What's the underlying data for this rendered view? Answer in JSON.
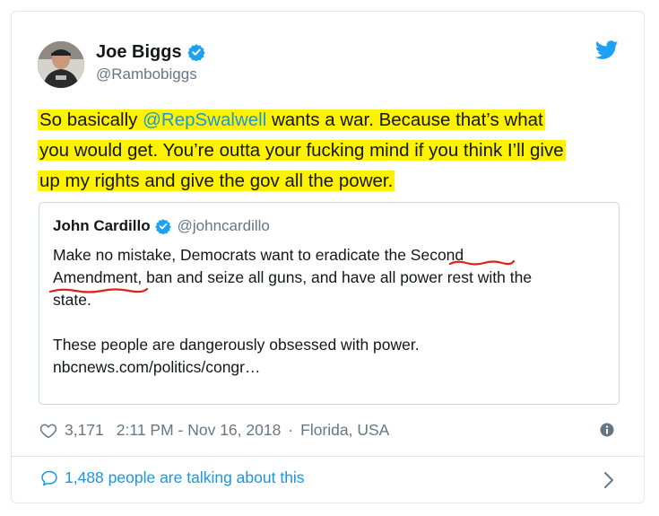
{
  "author": {
    "name": "Joe Biggs",
    "handle": "@Rambobiggs"
  },
  "tweet": {
    "line1_prefix": "So basically ",
    "mention": "@RepSwalwell",
    "line1_suffix": " wants a war. Because that’s what",
    "line2": "you would get. You’re outta your fucking mind if you think I’ll give",
    "line3": "up my rights and give the gov all the power."
  },
  "quote": {
    "name": "John Cardillo",
    "handle": "@johncardillo",
    "line1": "Make no mistake, Democrats want to eradicate the Second",
    "line2": "Amendment, ban and seize all guns, and have all power rest with the",
    "line3": "state.",
    "line4": "These people are dangerously obsessed with power.",
    "line5": "nbcnews.com/politics/congr…"
  },
  "meta": {
    "likes": "3,171",
    "timestamp": "2:11 PM - Nov 16, 2018",
    "separator": "·",
    "location": "Florida, USA"
  },
  "footer": {
    "talking": "1,488 people are talking about this"
  },
  "colors": {
    "highlight": "#fff200",
    "link": "#1b95e0",
    "twitter_blue": "#1da1f2",
    "annotation_red": "#e0201b"
  },
  "icons": [
    "verified-icon",
    "twitter-bird-icon",
    "heart-icon",
    "info-icon",
    "speech-bubble-icon",
    "chevron-right-icon"
  ]
}
